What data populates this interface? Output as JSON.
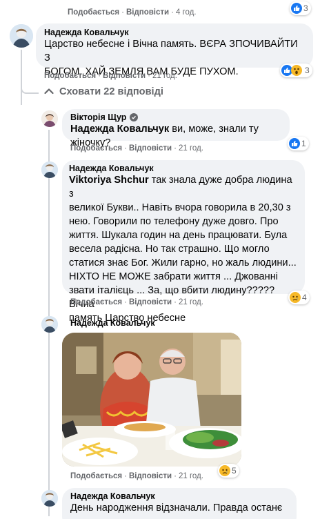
{
  "comments": [
    {
      "actions": {
        "like": "Подобається",
        "reply": "Відповісти",
        "time": "4 год."
      },
      "reactions": {
        "count": "3",
        "icons": [
          "like-icon"
        ]
      }
    },
    {
      "author": "Надежда Ковальчук",
      "lines": [
        "Царство небесне і Вічна память. ВЄРА ЗПОЧИВАЙТИ З",
        "БОГОМ. ХАЙ ЗЕМЛЯ ВАМ БУДЕ ПУХОМ."
      ],
      "actions": {
        "like": "Подобається",
        "reply": "Відповісти",
        "time": "21 год."
      },
      "reactions": {
        "count": "3",
        "icons": [
          "like-icon",
          "wow-icon"
        ]
      }
    }
  ],
  "hide_replies": "Сховати 22 відповіді",
  "replies": [
    {
      "author": "Вікторія Щур",
      "verified": true,
      "mention": "Надежда Ковальчук",
      "text": " ви, може, знали ту жіночку?",
      "actions": {
        "like": "Подобається",
        "reply": "Відповісти",
        "time": "21 год."
      },
      "reactions": {
        "count": "1",
        "icons": [
          "like-icon"
        ]
      }
    },
    {
      "author": "Надежда Ковальчук",
      "mention": "Viktoriya Shchur",
      "lines": [
        " так знала дуже добра людина з",
        "великої Букви.. Навіть вчора говорила в 20,30 з",
        "нею. Говорили по телефону дуже довго. Про",
        "життя. Шукала годин на день працювати. Була",
        "весела радісна. Но так страшно. Що могло",
        "статися знає Бог. Жили гарно, но жаль людини...",
        "НІХТО НЕ МОЖЕ забрати життя ... Джованні",
        "звати італієць ... За, що вбити людину????? Вічна",
        "память Царство небесне"
      ],
      "actions": {
        "like": "Подобається",
        "reply": "Відповісти",
        "time": "21 год."
      },
      "reactions": {
        "count": "4",
        "icons": [
          "sad-icon"
        ]
      }
    },
    {
      "author": "Надежда Ковальчук",
      "photo": "photo-couple-at-dinner",
      "actions": {
        "like": "Подобається",
        "reply": "Відповісти",
        "time": "21 год."
      },
      "reactions": {
        "count": "5",
        "icons": [
          "sad-icon"
        ]
      }
    },
    {
      "author": "Надежда Ковальчук",
      "lines": [
        "День народження відзначали. Правда останє"
      ]
    }
  ],
  "colors": {
    "bubble": "#f0f2f5",
    "secondary_text": "#65676b",
    "like_blue": "#1877f2",
    "reaction_yellow": "#f7b928"
  }
}
